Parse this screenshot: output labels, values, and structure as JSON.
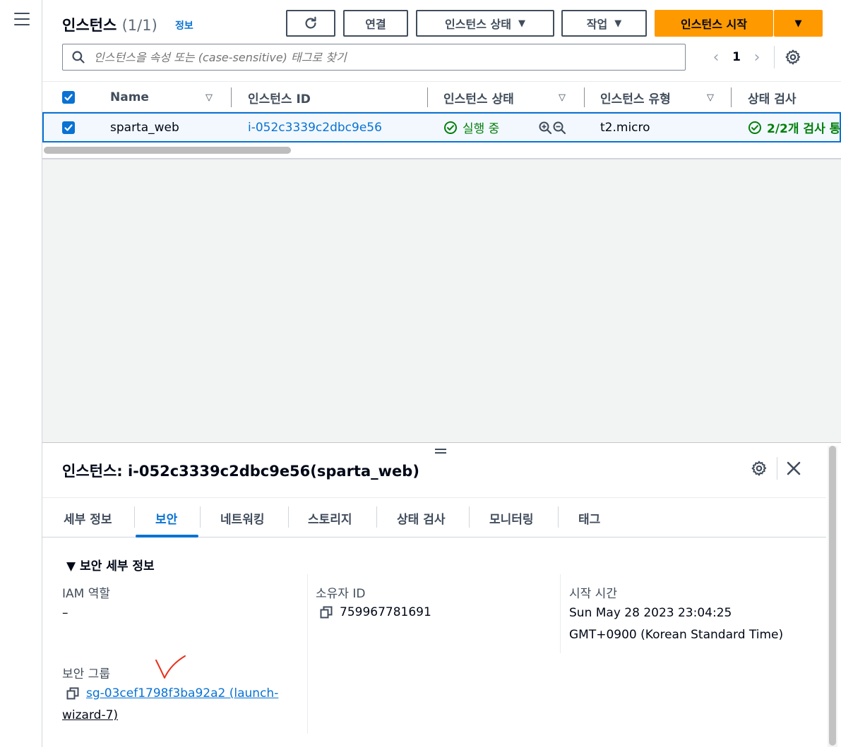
{
  "header": {
    "title": "인스턴스",
    "count": "(1/1)",
    "info_link": "정보",
    "buttons": {
      "connect": "연결",
      "instance_state": "인스턴스 상태",
      "actions": "작업",
      "launch": "인스턴스 시작"
    },
    "search_placeholder": "인스턴스을 속성 또는 (case-sensitive) 태그로 찾기",
    "page_number": "1"
  },
  "table": {
    "columns": [
      "Name",
      "인스턴스 ID",
      "인스턴스 상태",
      "인스턴스 유형",
      "상태 검사"
    ],
    "rows": [
      {
        "name": "sparta_web",
        "instance_id": "i-052c3339c2dbc9e56",
        "state": "실행 중",
        "type": "t2.micro",
        "status_check": "2/2개 검사 통"
      }
    ]
  },
  "panel": {
    "title": "인스턴스: i-052c3339c2dbc9e56(sparta_web)",
    "tabs": [
      "세부 정보",
      "보안",
      "네트워킹",
      "스토리지",
      "상태 검사",
      "모니터링",
      "태그"
    ],
    "active_tab": "보안",
    "section_title": "▼ 보안 세부 정보",
    "iam_role_label": "IAM 역할",
    "iam_role_value": "–",
    "owner_id_label": "소유자 ID",
    "owner_id_value": "759967781691",
    "launch_time_label": "시작 시간",
    "launch_time_line1": "Sun May 28 2023 23:04:25",
    "launch_time_line2": "GMT+0900 (Korean Standard Time)",
    "security_group_label": "보안 그룹",
    "security_group_line1": "sg-03cef1798f3ba92a2 (launch-",
    "security_group_line2": "wizard-7)"
  },
  "colors": {
    "accent": "#0972d3",
    "primary_button": "#ff9900",
    "success": "#037f0c",
    "annotation_mark": "#e8311a"
  }
}
